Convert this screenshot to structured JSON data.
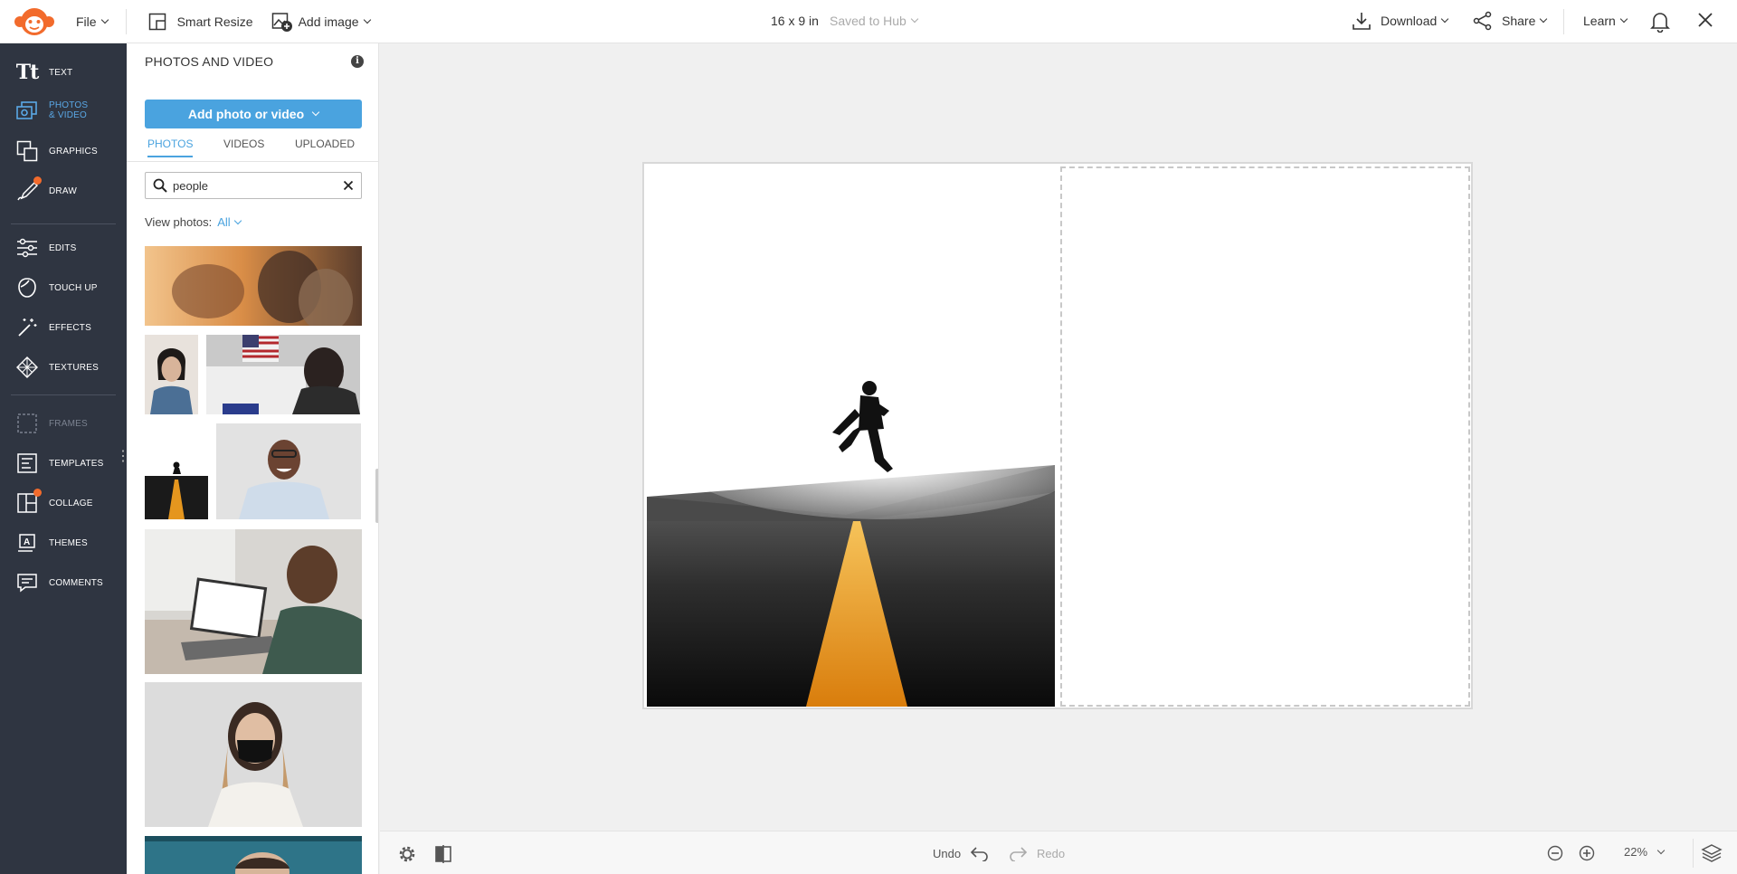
{
  "topbar": {
    "file_label": "File",
    "smart_resize_label": "Smart Resize",
    "add_image_label": "Add image",
    "doc_size": "16 x 9 in",
    "save_status": "Saved to Hub",
    "download_label": "Download",
    "share_label": "Share",
    "learn_label": "Learn"
  },
  "leftnav": {
    "items": [
      {
        "label": "TEXT"
      },
      {
        "label": "PHOTOS\n& VIDEO"
      },
      {
        "label": "GRAPHICS"
      },
      {
        "label": "DRAW"
      },
      {
        "label": "EDITS"
      },
      {
        "label": "TOUCH UP"
      },
      {
        "label": "EFFECTS"
      },
      {
        "label": "TEXTURES"
      },
      {
        "label": "FRAMES"
      },
      {
        "label": "TEMPLATES"
      },
      {
        "label": "COLLAGE"
      },
      {
        "label": "THEMES"
      },
      {
        "label": "COMMENTS"
      }
    ]
  },
  "panel": {
    "title": "PHOTOS AND VIDEO",
    "add_button_label": "Add photo or video",
    "tabs": [
      {
        "label": "PHOTOS"
      },
      {
        "label": "VIDEOS"
      },
      {
        "label": "UPLOADED"
      }
    ],
    "search_value": "people",
    "view_photos_label": "View photos:",
    "view_photos_value": "All"
  },
  "bottombar": {
    "undo_label": "Undo",
    "redo_label": "Redo",
    "zoom_value": "22%"
  },
  "colors": {
    "accent": "#4aa3df",
    "nav_bg": "#2f3541",
    "notification_dot": "#f26b2c",
    "logo_orange": "#f26b2c"
  }
}
